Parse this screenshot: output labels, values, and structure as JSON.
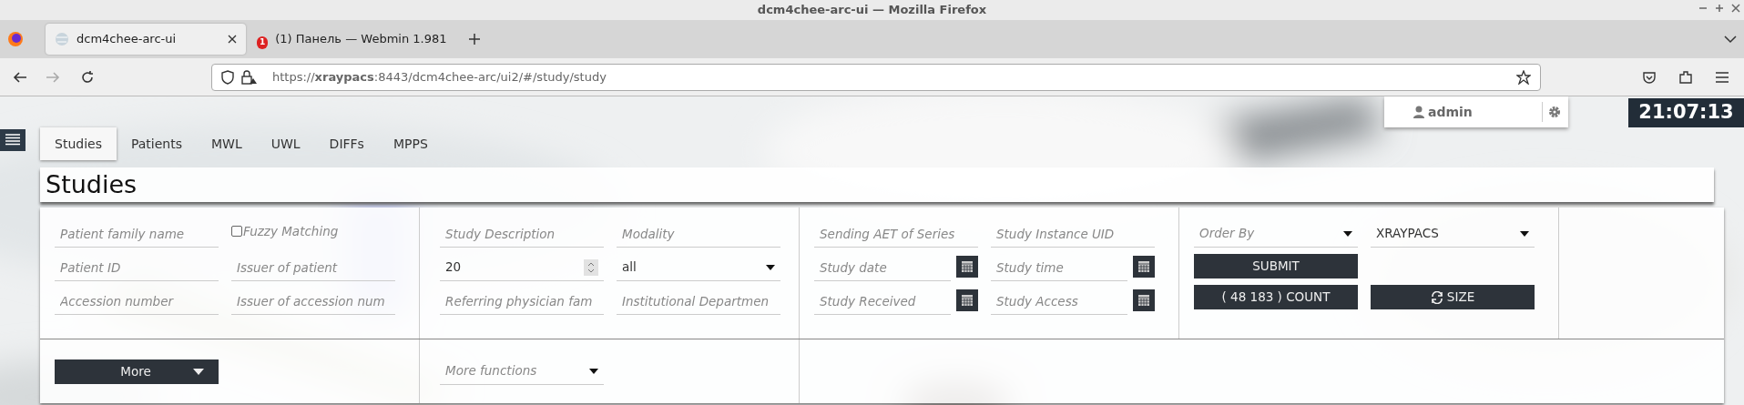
{
  "window": {
    "title": "dcm4chee-arc-ui — Mozilla Firefox"
  },
  "browser_tabs": [
    {
      "title": "dcm4chee-arc-ui",
      "selected": true
    },
    {
      "title": "(1) Панель — Webmin 1.981",
      "selected": false,
      "badge": "1"
    }
  ],
  "address_bar": {
    "url": "https://**xraypacs**:8443/dcm4chee-arc/ui2/#/study/study"
  },
  "user": {
    "name": "admin"
  },
  "clock": "21:07:13",
  "app_tabs": [
    {
      "label": "Studies",
      "selected": true
    },
    {
      "label": "Patients",
      "selected": false
    },
    {
      "label": "MWL",
      "selected": false
    },
    {
      "label": "UWL",
      "selected": false
    },
    {
      "label": "DIFFs",
      "selected": false
    },
    {
      "label": "MPPS",
      "selected": false
    }
  ],
  "page_title": "Studies",
  "filter_columns": [
    {
      "fields": [
        {
          "kind": "input",
          "placeholder": "Patient family name"
        },
        {
          "kind": "checkbox",
          "label": "Fuzzy Matching",
          "checked": false
        },
        {
          "kind": "input",
          "placeholder": "Patient ID"
        },
        {
          "kind": "input",
          "placeholder": "Issuer of patient"
        },
        {
          "kind": "input",
          "placeholder": "Accession number"
        },
        {
          "kind": "input",
          "placeholder": "Issuer of accession num"
        }
      ]
    },
    {
      "fields": [
        {
          "kind": "input",
          "placeholder": "Study Description"
        },
        {
          "kind": "input",
          "placeholder": "Modality"
        },
        {
          "kind": "number",
          "value": "20"
        },
        {
          "kind": "select",
          "value": "all"
        },
        {
          "kind": "input",
          "placeholder": "Referring physician fam"
        },
        {
          "kind": "input",
          "placeholder": "Institutional Departmen"
        }
      ]
    },
    {
      "fields": [
        {
          "kind": "input",
          "placeholder": "Sending AET of Series"
        },
        {
          "kind": "input",
          "placeholder": "Study Instance UID"
        },
        {
          "kind": "date",
          "placeholder": "Study date"
        },
        {
          "kind": "date",
          "placeholder": "Study time"
        },
        {
          "kind": "date",
          "placeholder": "Study Received"
        },
        {
          "kind": "date",
          "placeholder": "Study Access"
        }
      ]
    },
    {
      "fields": [
        {
          "kind": "select",
          "placeholder": "Order By"
        },
        {
          "kind": "select",
          "value": "XRAYPACS"
        },
        {
          "kind": "button",
          "label": "SUBMIT"
        },
        {
          "kind": "spacer"
        },
        {
          "kind": "button",
          "label": "( 48 183 ) COUNT"
        },
        {
          "kind": "refresh-button",
          "label": "SIZE"
        }
      ]
    }
  ],
  "more_button": {
    "label": "More"
  },
  "more_functions": {
    "placeholder": "More functions"
  }
}
